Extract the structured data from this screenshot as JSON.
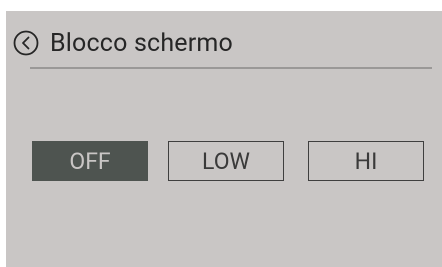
{
  "header": {
    "title": "Blocco schermo",
    "back_icon": "chevron-left-circle-icon"
  },
  "options": {
    "selected": "OFF",
    "items": [
      {
        "label": "OFF"
      },
      {
        "label": "LOW"
      },
      {
        "label": "HI"
      }
    ]
  },
  "colors": {
    "background": "#c9c6c5",
    "selected_fill": "#4e5450",
    "selected_text": "#c9c6c5",
    "text": "#262626",
    "border": "#3f3f3f",
    "divider": "#9a9897"
  }
}
